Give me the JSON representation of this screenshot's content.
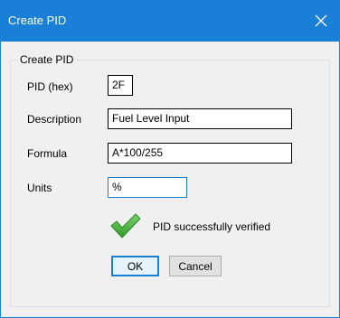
{
  "window": {
    "title": "Create PID",
    "close_icon": "close-icon"
  },
  "group": {
    "legend": "Create PID"
  },
  "form": {
    "pid_label": "PID (hex)",
    "pid_value": "2F",
    "description_label": "Description",
    "description_value": "Fuel Level Input",
    "formula_label": "Formula",
    "formula_value": "A*100/255",
    "units_label": "Units",
    "units_value": "%"
  },
  "status": {
    "icon": "checkmark-icon",
    "text": "PID successfully verified",
    "color": "#3fa535"
  },
  "buttons": {
    "ok": "OK",
    "cancel": "Cancel"
  },
  "colors": {
    "accent": "#1a7fd6"
  }
}
